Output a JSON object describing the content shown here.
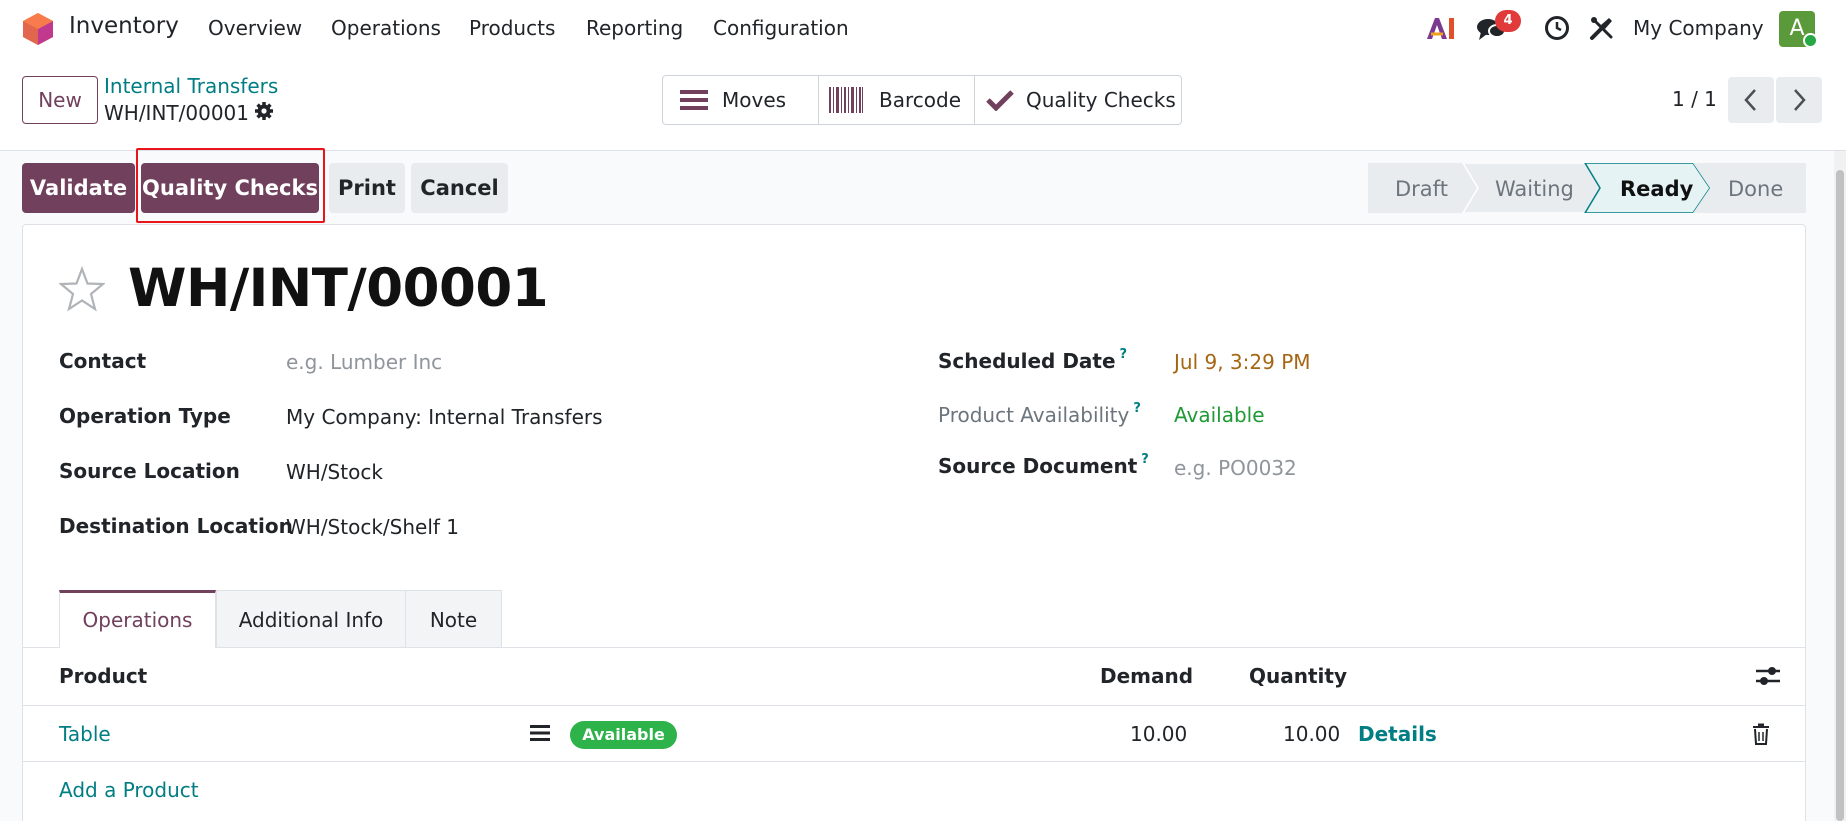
{
  "navbar": {
    "app_name": "Inventory",
    "menu": [
      "Overview",
      "Operations",
      "Products",
      "Reporting",
      "Configuration"
    ],
    "messages_count": "4",
    "company": "My Company",
    "avatar_letter": "A"
  },
  "control_panel": {
    "new_label": "New",
    "breadcrumb": "Internal Transfers",
    "record_name": "WH/INT/00001",
    "smart_buttons": [
      "Moves",
      "Barcode",
      "Quality Checks"
    ],
    "pager": "1 / 1"
  },
  "actions": {
    "validate": "Validate",
    "quality_checks": "Quality Checks",
    "print": "Print",
    "cancel": "Cancel"
  },
  "status": {
    "stages": [
      "Draft",
      "Waiting",
      "Ready",
      "Done"
    ],
    "current": "Ready"
  },
  "form": {
    "title": "WH/INT/00001",
    "contact_label": "Contact",
    "contact_placeholder": "e.g. Lumber Inc",
    "operation_type_label": "Operation Type",
    "operation_type": "My Company: Internal Transfers",
    "source_location_label": "Source Location",
    "source_location": "WH/Stock",
    "destination_location_label": "Destination Location",
    "destination_location": "WH/Stock/Shelf 1",
    "scheduled_date_label": "Scheduled Date",
    "scheduled_date": "Jul 9, 3:29 PM",
    "product_availability_label": "Product Availability",
    "product_availability": "Available",
    "source_document_label": "Source Document",
    "source_document_placeholder": "e.g. PO0032",
    "help_mark": "?"
  },
  "tabs": [
    "Operations",
    "Additional Info",
    "Note"
  ],
  "table": {
    "headers": {
      "product": "Product",
      "demand": "Demand",
      "quantity": "Quantity"
    },
    "rows": [
      {
        "product": "Table",
        "status": "Available",
        "demand": "10.00",
        "quantity": "10.00",
        "details": "Details"
      }
    ],
    "add_product": "Add a Product"
  },
  "colors": {
    "primary": "#71405d",
    "link": "#017e84",
    "available": "#2eb34a",
    "highlight": "#e8151b"
  }
}
